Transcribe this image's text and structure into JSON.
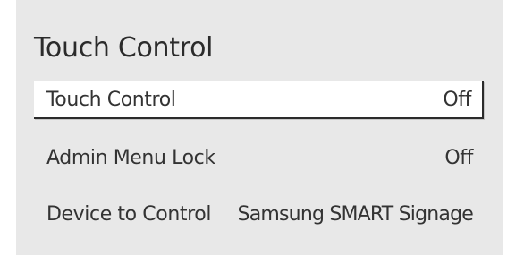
{
  "menu": {
    "title": "Touch Control",
    "items": [
      {
        "label": "Touch Control",
        "value": "Off",
        "selected": true
      },
      {
        "label": "Admin Menu Lock",
        "value": "Off",
        "selected": false
      },
      {
        "label": "Device to Control",
        "value": "Samsung SMART Signage",
        "selected": false
      }
    ]
  },
  "colors": {
    "panel_bg": "#e8e8e8",
    "selected_bg": "#ffffff",
    "text": "#333333",
    "selection_border": "#2b2b2b"
  }
}
